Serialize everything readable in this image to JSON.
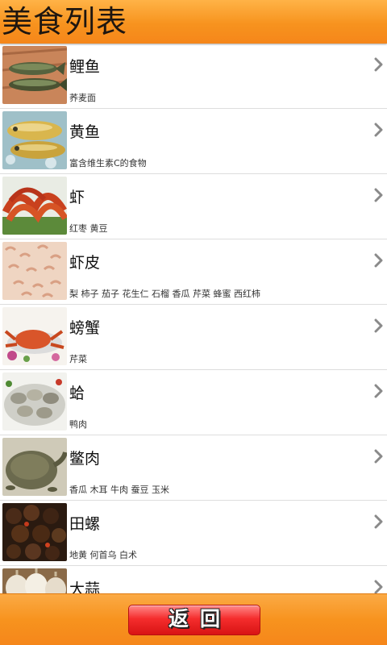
{
  "header": {
    "title": "美食列表"
  },
  "items": [
    {
      "title": "鲤鱼",
      "subtitle": "荞麦面",
      "image": "carp-image"
    },
    {
      "title": "黄鱼",
      "subtitle": "富含维生素C的食物",
      "image": "yellow-croaker-image"
    },
    {
      "title": "虾",
      "subtitle": "红枣 黄豆",
      "image": "shrimp-image"
    },
    {
      "title": "虾皮",
      "subtitle": "梨 柿子 茄子 花生仁 石榴 香瓜 芹菜 蜂蜜 西红柿",
      "image": "dried-shrimp-image"
    },
    {
      "title": "螃蟹",
      "subtitle": "芹菜",
      "image": "crab-image"
    },
    {
      "title": "蛤",
      "subtitle": "鸭肉",
      "image": "clam-image"
    },
    {
      "title": "鳖肉",
      "subtitle": "香瓜 木耳 牛肉 蚕豆 玉米",
      "image": "softshell-turtle-image"
    },
    {
      "title": "田螺",
      "subtitle": "地黄 何首乌 白术",
      "image": "river-snail-image"
    },
    {
      "title": "大蒜",
      "subtitle": "",
      "image": "garlic-image"
    }
  ],
  "footer": {
    "back_label": "返回"
  },
  "icons": {
    "row_arrow": "chevron-right-icon"
  },
  "colors": {
    "header": "#f7931e",
    "button": "#f52d2d"
  }
}
